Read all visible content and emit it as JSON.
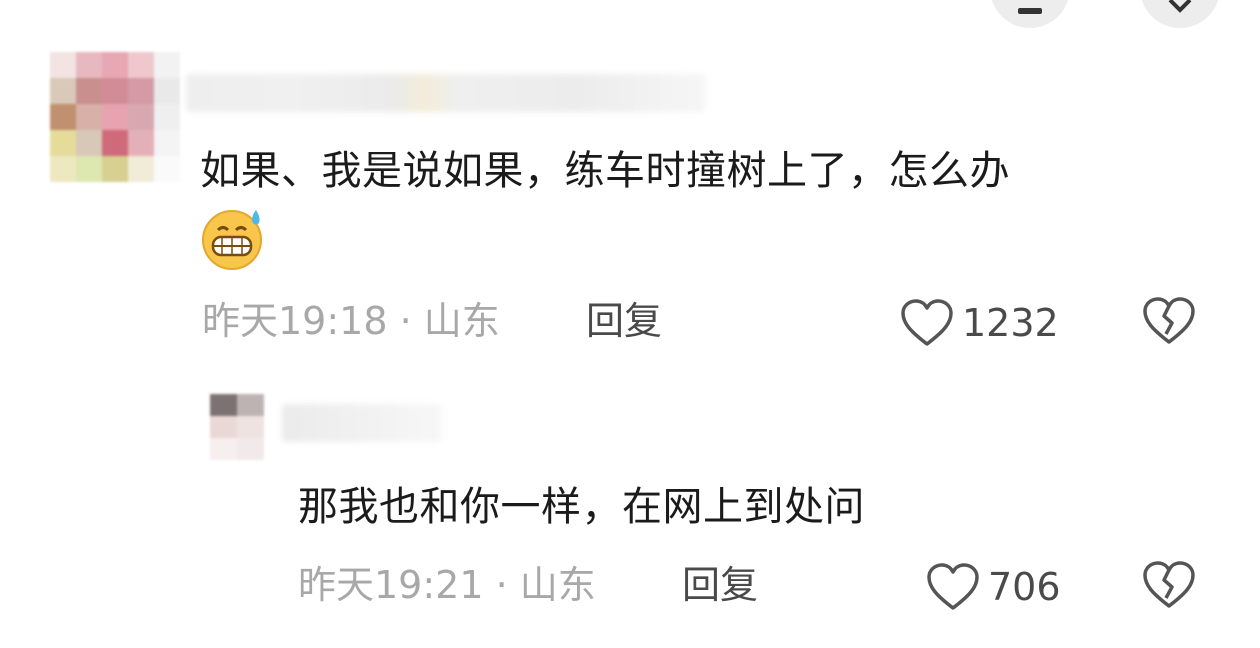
{
  "header": {
    "profile_icon": "person-icon",
    "close_icon": "close-icon"
  },
  "comments": [
    {
      "text": "如果、我是说如果，练车时撞树上了，怎么办",
      "emoji": "grinning-sweat-emoji",
      "time_location": "昨天19:18 · 山东",
      "reply_label": "回复",
      "likes": "1232"
    },
    {
      "text": "那我也和你一样，在网上到处问",
      "time_location": "昨天19:21 · 山东",
      "reply_label": "回复",
      "likes": "706"
    }
  ],
  "colors": {
    "text": "#1b1b1b",
    "meta": "#a8a8a8",
    "action": "#4a4a4a",
    "icon": "#555555"
  }
}
